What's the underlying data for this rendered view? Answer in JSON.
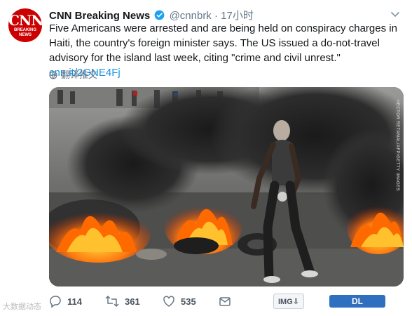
{
  "account": {
    "avatar_logo": "CNN",
    "avatar_sub": "BREAKING NEWS",
    "name": "CNN Breaking News",
    "handle": "@cnnbrk",
    "dot": "·",
    "time": "17小时"
  },
  "tweet": {
    "text": "Five Americans were arrested and are being held on conspiracy charges in Haiti, the country's foreign minister says. The US issued a do-not-travel advisory for the island last week, citing \"crime and civil unrest.\"",
    "link": "cnn.it/2GNE4Fj",
    "translate_label": "翻译推文"
  },
  "media": {
    "credit": "HECTOR RETAMAL/AFP/GETTY IMAGES"
  },
  "actions": {
    "replies": "114",
    "retweets": "361",
    "likes": "535",
    "img_button": "IMG⇩",
    "dl_button": "DL"
  },
  "watermark": "大数据动态",
  "colors": {
    "link": "#1b95e0",
    "verified": "#1da1f2",
    "cnn_red": "#cc0000",
    "dl_blue": "#2f6fbf"
  },
  "icons": [
    "cnn-logo-icon",
    "verified-badge-icon",
    "chevron-down-icon",
    "globe-icon",
    "reply-icon",
    "retweet-icon",
    "like-icon",
    "message-icon"
  ]
}
